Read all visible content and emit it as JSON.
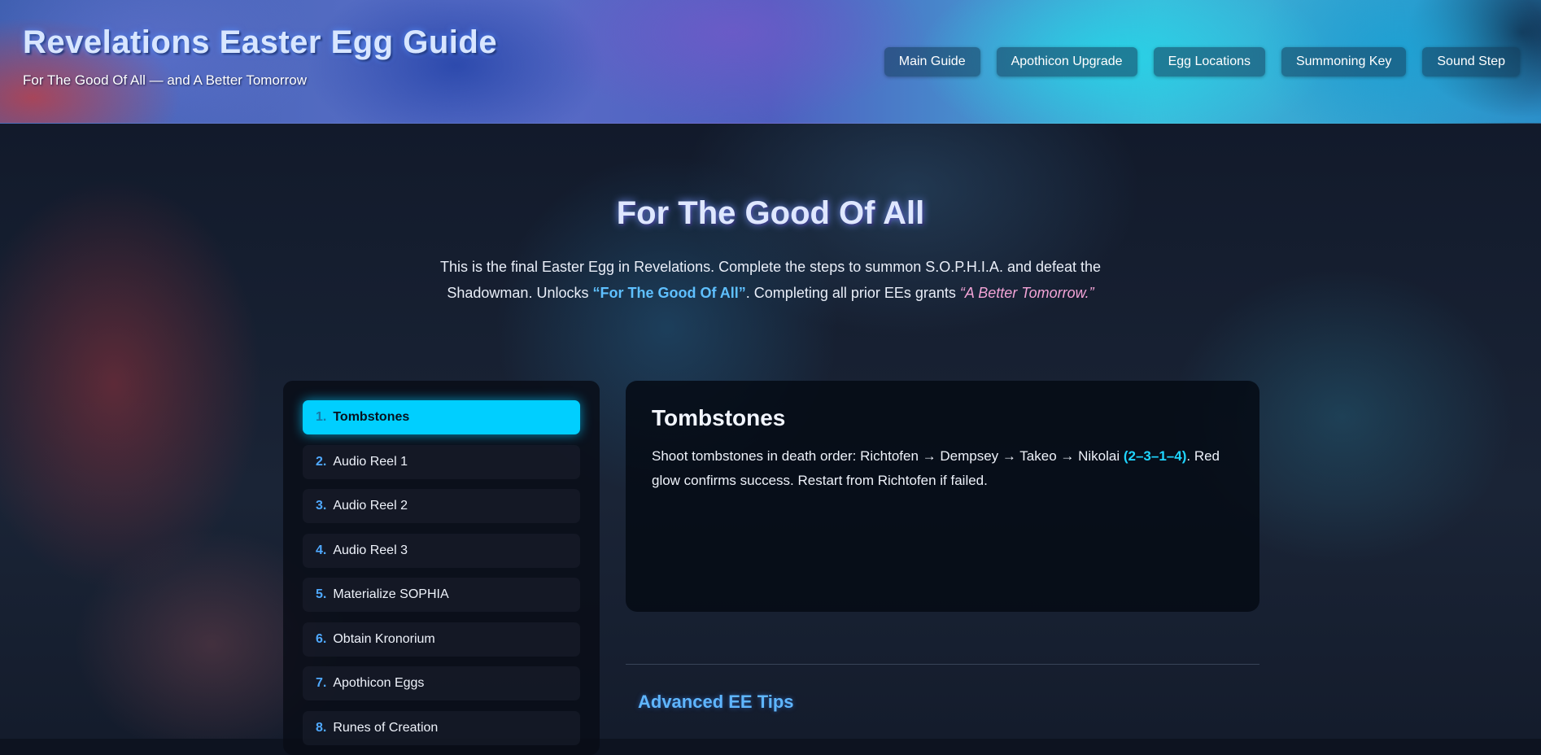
{
  "header": {
    "title": "Revelations Easter Egg Guide",
    "subtitle": "For The Good Of All — and A Better Tomorrow",
    "nav": [
      {
        "label": "Main Guide"
      },
      {
        "label": "Apothicon Upgrade"
      },
      {
        "label": "Egg Locations"
      },
      {
        "label": "Summoning Key"
      },
      {
        "label": "Sound Step"
      }
    ]
  },
  "hero": {
    "title": "For The Good Of All",
    "desc_part1": "This is the final Easter Egg in Revelations. Complete the steps to summon S.O.P.H.I.A. and defeat the Shadowman. Unlocks ",
    "desc_highlight_title": "“For The Good Of All”",
    "desc_part2": ". Completing all prior EEs grants ",
    "desc_highlight_award": "“A Better Tomorrow.”"
  },
  "steps": {
    "active_index": 0,
    "items": [
      {
        "num": "1.",
        "label": "Tombstones"
      },
      {
        "num": "2.",
        "label": "Audio Reel 1"
      },
      {
        "num": "3.",
        "label": "Audio Reel 2"
      },
      {
        "num": "4.",
        "label": "Audio Reel 3"
      },
      {
        "num": "5.",
        "label": "Materialize SOPHIA"
      },
      {
        "num": "6.",
        "label": "Obtain Kronorium"
      },
      {
        "num": "7.",
        "label": "Apothicon Eggs"
      },
      {
        "num": "8.",
        "label": "Runes of Creation"
      }
    ]
  },
  "detail": {
    "title": "Tombstones",
    "text_part1": "Shoot tombstones in death order: Richtofen → Dempsey → Takeo → Nikolai ",
    "text_code": "(2–3–1–4)",
    "text_part2": ". Red glow confirms success. Restart from Richtofen if failed."
  },
  "tips": {
    "title": "Advanced EE Tips"
  },
  "colors": {
    "accent": "#00cfff",
    "title_highlight": "#5fc0ff",
    "award_highlight": "#f2a3d6",
    "step_number": "#4fa9ff"
  }
}
